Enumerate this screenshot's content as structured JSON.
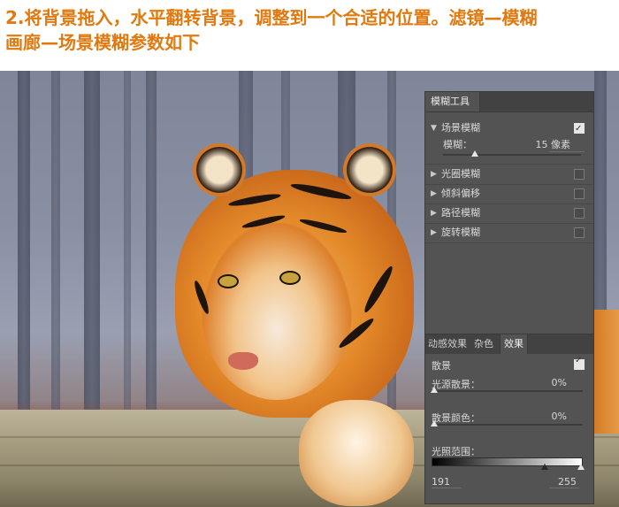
{
  "caption": {
    "line1": "2.将背景拖入，水平翻转背景，调整到一个合适的位置。滤镜—模糊",
    "line2": "画廊—场景模糊参数如下"
  },
  "panel": {
    "tab_label": "模糊工具",
    "blur_tools": [
      {
        "label": "场景模糊",
        "checked": true,
        "expanded": true
      },
      {
        "label": "光圈模糊",
        "checked": false,
        "expanded": false
      },
      {
        "label": "倾斜偏移",
        "checked": false,
        "expanded": false
      },
      {
        "label": "路径模糊",
        "checked": false,
        "expanded": false
      },
      {
        "label": "旋转模糊",
        "checked": false,
        "expanded": false
      }
    ],
    "blur_param": {
      "label": "模糊：",
      "value": "15 像素"
    },
    "lower_tabs": [
      "动感效果",
      "杂色",
      "效果"
    ],
    "active_lower_tab": "效果",
    "bokeh": {
      "label": "散景",
      "checked": true,
      "light_bokeh": {
        "label": "光源散景：",
        "value": "0%"
      },
      "bokeh_color": {
        "label": "散景颜色：",
        "value": "0%"
      },
      "light_range": {
        "label": "光照范围：",
        "low": "191",
        "high": "255"
      }
    }
  },
  "colors": {
    "caption": "#e07a10",
    "panel_bg": "#535353",
    "panel_tabbar": "#424242"
  }
}
